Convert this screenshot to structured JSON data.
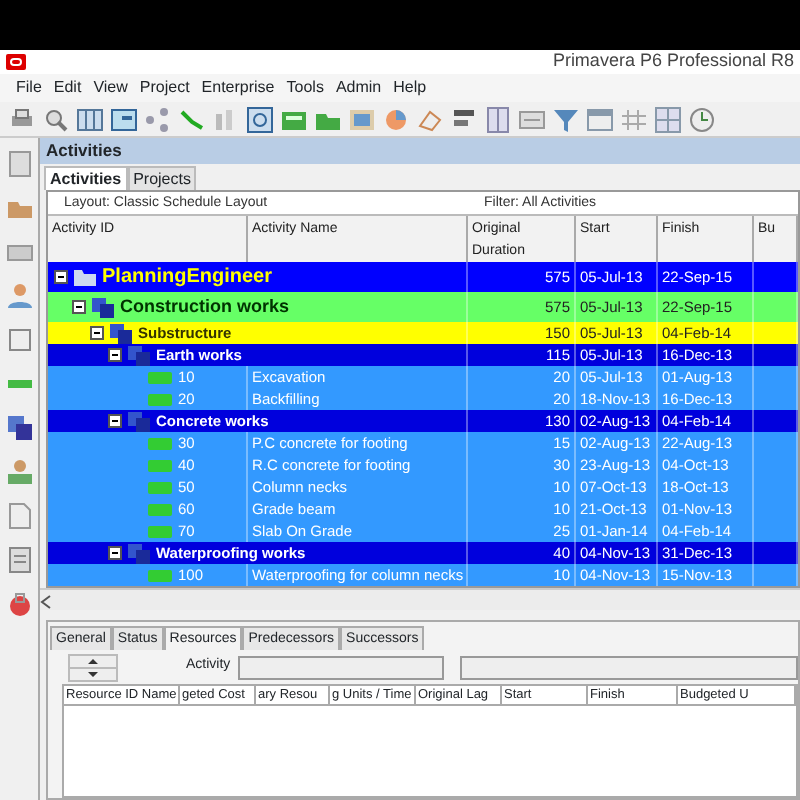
{
  "window": {
    "title": "Primavera P6 Professional R8"
  },
  "menu": [
    "File",
    "Edit",
    "View",
    "Project",
    "Enterprise",
    "Tools",
    "Admin",
    "Help"
  ],
  "panel": {
    "title": "Activities"
  },
  "tabs": [
    {
      "label": "Activities",
      "selected": true
    },
    {
      "label": "Projects",
      "selected": false
    }
  ],
  "layout": "Layout: Classic Schedule Layout",
  "filter": "Filter: All Activities",
  "columns": [
    "Activity ID",
    "Activity Name",
    "Original Duration",
    "Start",
    "Finish",
    "Bu"
  ],
  "rows": [
    {
      "kind": "project",
      "name": "PlanningEngineer",
      "duration": "575",
      "start": "05-Jul-13",
      "finish": "22-Sep-15",
      "expanded": true,
      "children": [
        {
          "kind": "wbs",
          "name": "Construction works",
          "duration": "575",
          "start": "05-Jul-13",
          "finish": "22-Sep-15",
          "expanded": true,
          "children": [
            {
              "kind": "wbs",
              "name": "Substructure",
              "duration": "150",
              "start": "05-Jul-13",
              "finish": "04-Feb-14",
              "expanded": true,
              "children": [
                {
                  "kind": "wbs",
                  "name": "Earth works",
                  "duration": "115",
                  "start": "05-Jul-13",
                  "finish": "16-Dec-13",
                  "expanded": true,
                  "children": [
                    {
                      "kind": "activity",
                      "id": "10",
                      "name": "Excavation",
                      "duration": "20",
                      "start": "05-Jul-13",
                      "finish": "01-Aug-13"
                    },
                    {
                      "kind": "activity",
                      "id": "20",
                      "name": "Backfilling",
                      "duration": "20",
                      "start": "18-Nov-13",
                      "finish": "16-Dec-13"
                    }
                  ]
                },
                {
                  "kind": "wbs",
                  "name": "Concrete works",
                  "duration": "130",
                  "start": "02-Aug-13",
                  "finish": "04-Feb-14",
                  "expanded": true,
                  "children": [
                    {
                      "kind": "activity",
                      "id": "30",
                      "name": "P.C concrete for footing",
                      "duration": "15",
                      "start": "02-Aug-13",
                      "finish": "22-Aug-13"
                    },
                    {
                      "kind": "activity",
                      "id": "40",
                      "name": "R.C concrete for footing",
                      "duration": "30",
                      "start": "23-Aug-13",
                      "finish": "04-Oct-13"
                    },
                    {
                      "kind": "activity",
                      "id": "50",
                      "name": "Column necks",
                      "duration": "10",
                      "start": "07-Oct-13",
                      "finish": "18-Oct-13"
                    },
                    {
                      "kind": "activity",
                      "id": "60",
                      "name": "Grade beam",
                      "duration": "10",
                      "start": "21-Oct-13",
                      "finish": "01-Nov-13"
                    },
                    {
                      "kind": "activity",
                      "id": "70",
                      "name": "Slab On Grade",
                      "duration": "25",
                      "start": "01-Jan-14",
                      "finish": "04-Feb-14"
                    }
                  ]
                },
                {
                  "kind": "wbs",
                  "name": "Waterproofing works",
                  "duration": "40",
                  "start": "04-Nov-13",
                  "finish": "31-Dec-13",
                  "expanded": true,
                  "children": [
                    {
                      "kind": "activity",
                      "id": "100",
                      "name": "Waterproofing for column necks",
                      "duration": "10",
                      "start": "04-Nov-13",
                      "finish": "15-Nov-13"
                    }
                  ]
                }
              ]
            }
          ]
        }
      ]
    }
  ],
  "detail_tabs": [
    {
      "label": "General",
      "selected": false
    },
    {
      "label": "Status",
      "selected": false
    },
    {
      "label": "Resources",
      "selected": true
    },
    {
      "label": "Predecessors",
      "selected": false
    },
    {
      "label": "Successors",
      "selected": false
    }
  ],
  "activity_label": "Activity",
  "resource_columns": [
    "Resource ID Name",
    "geted Cost",
    "ary Resou",
    "g Units / Time",
    "Original Lag",
    "Start",
    "Finish",
    "Budgeted U"
  ]
}
